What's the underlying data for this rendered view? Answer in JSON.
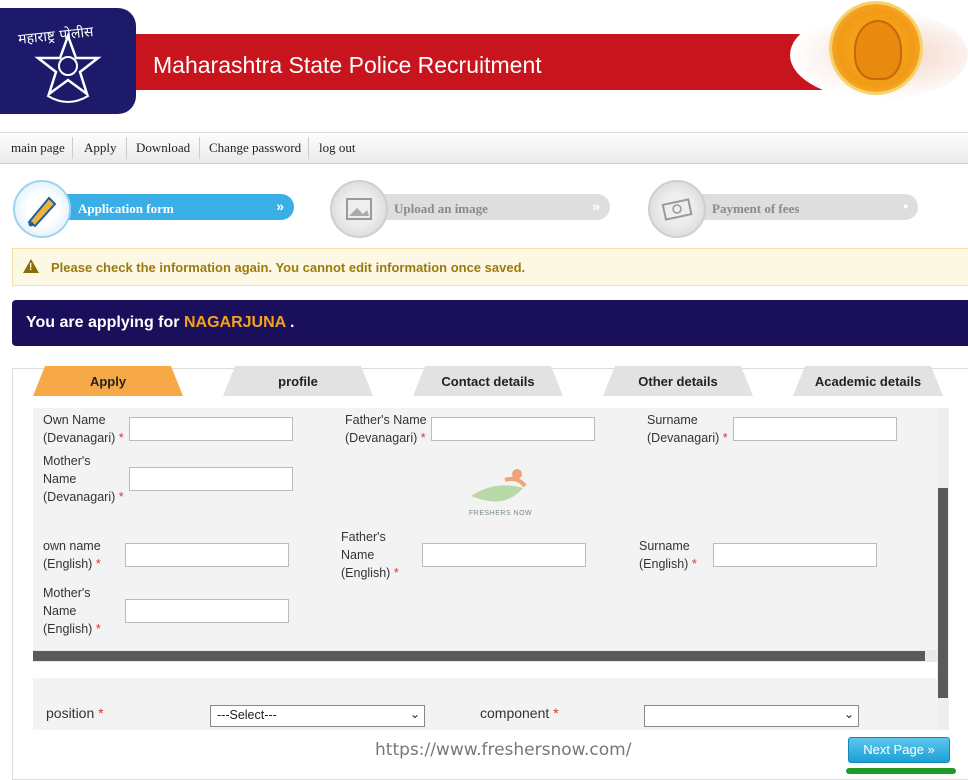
{
  "header": {
    "logo_top_text": "महाराष्ट्र पोलीस",
    "title": "Maharashtra State Police Recruitment"
  },
  "menu": [
    "main page",
    "Apply",
    "Download",
    "Change password",
    "log out"
  ],
  "steps": [
    {
      "label": "Application form",
      "status": "active",
      "icon": "pen-nib-icon"
    },
    {
      "label": "Upload an image",
      "status": "inactive",
      "icon": "image-icon"
    },
    {
      "label": "Payment of fees",
      "status": "inactive",
      "icon": "money-icon"
    }
  ],
  "warning": "Please check the information again. You cannot edit information once saved.",
  "applying": {
    "prefix": "You are applying for ",
    "name": "NAGARJUNA",
    "suffix": " ."
  },
  "tabs": [
    "Apply",
    "profile",
    "Contact details",
    "Other details",
    "Academic details"
  ],
  "form": {
    "own_name_dev": [
      "Own Name",
      "(Devanagari)"
    ],
    "father_name_dev": [
      "Father's Name",
      "(Devanagari)"
    ],
    "surname_dev": [
      "Surname",
      "(Devanagari)"
    ],
    "mother_name_dev": [
      "Mother's",
      "Name",
      "(Devanagari)"
    ],
    "own_name_en": [
      "own name",
      "(English)"
    ],
    "father_name_en": [
      "Father's",
      "Name",
      "(English)"
    ],
    "surname_en": [
      "Surname",
      "(English)"
    ],
    "mother_name_en": [
      "Mother's",
      "Name",
      "(English)"
    ],
    "required_mark": "*",
    "position_label": "position",
    "position_value": "---Select---",
    "component_label": "component",
    "component_value": ""
  },
  "watermark": "FRESHERS NOW",
  "url": "https://www.freshersnow.com/",
  "next_button": "Next Page »",
  "colors": {
    "header_red": "#c8141c",
    "navy": "#1a0f5a",
    "orange": "#f6a21e",
    "step_blue": "#3aaee6",
    "tab_active": "#f7a948"
  }
}
